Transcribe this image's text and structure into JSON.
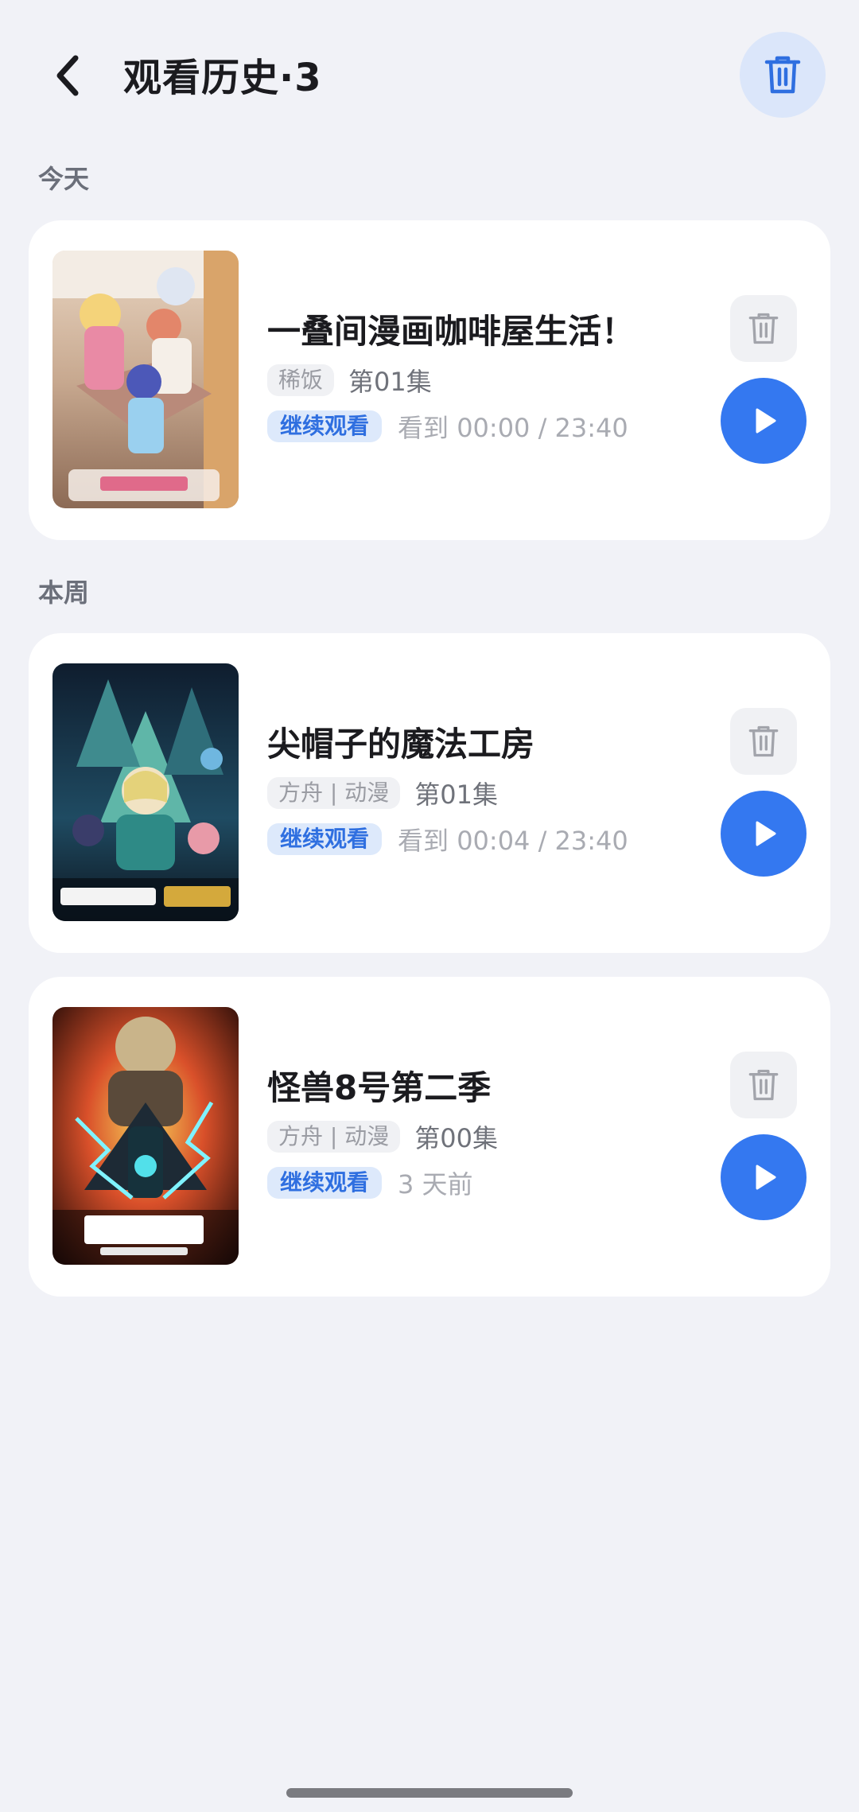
{
  "header": {
    "title": "观看历史·3",
    "back_icon": "chevron-left-icon",
    "clear_icon": "trash-icon"
  },
  "sections": [
    {
      "label": "今天",
      "items": [
        {
          "title": "一叠间漫画咖啡屋生活！",
          "source": "稀饭",
          "episode": "第01集",
          "continue_label": "继续观看",
          "progress": "看到 00:00 / 23:40"
        }
      ]
    },
    {
      "label": "本周",
      "items": [
        {
          "title": "尖帽子的魔法工房",
          "source": "方舟 | 动漫",
          "episode": "第01集",
          "continue_label": "继续观看",
          "progress": "看到 00:04 / 23:40"
        },
        {
          "title": "怪兽8号第二季",
          "source": "方舟 | 动漫",
          "episode": "第00集",
          "continue_label": "继续观看",
          "progress": "3 天前"
        }
      ]
    }
  ],
  "colors": {
    "accent": "#3478f0",
    "background": "#f1f2f7",
    "continue_text": "#2f6fe0"
  }
}
